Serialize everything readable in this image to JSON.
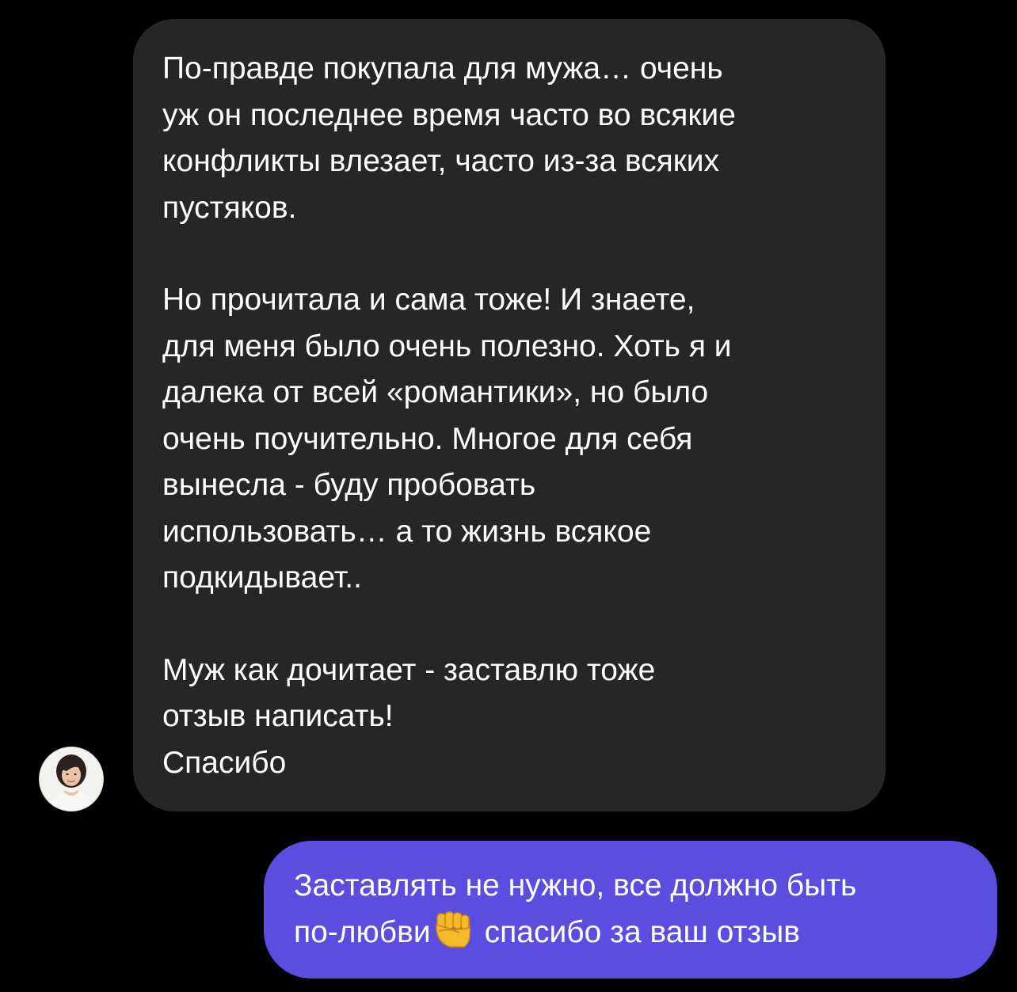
{
  "thread": {
    "incoming": {
      "paragraphs": [
        "По-правде покупала для мужа… очень\nуж он последнее время часто во всякие\nконфликты влезает, часто из-за всяких\nпустяков.",
        "Но прочитала и сама тоже! И знаете,\nдля меня было очень полезно. Хоть я и\nдалека от всей «романтики», но было\nочень поучительно. Многое для себя\nвынесла - буду пробовать\nиспользовать… а то жизнь всякое\nподкидывает..",
        "Муж как дочитает - заставлю тоже\nотзыв написать!\nСпасибо"
      ],
      "bubble_color": "#262626"
    },
    "outgoing": {
      "line1": "Заставлять не нужно, все должно быть",
      "line2_before": "по-любви",
      "emoji": "raised-fist-icon",
      "line2_after": "спасибо за ваш отзыв",
      "bubble_color": "#5b4de0"
    }
  }
}
